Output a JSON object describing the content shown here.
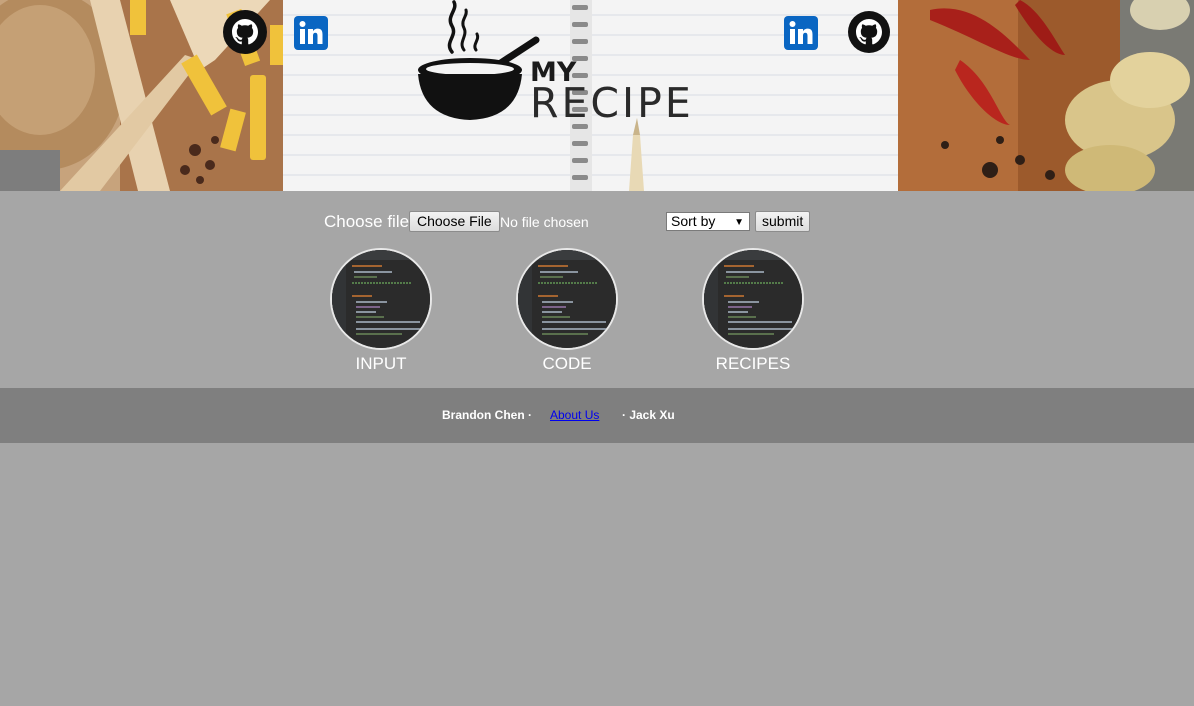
{
  "header": {
    "logo_my": "MY",
    "logo_recipe": "RECIPE",
    "social_links": [
      {
        "icon": "github-icon",
        "side": "left"
      },
      {
        "icon": "linkedin-icon",
        "side": "left"
      },
      {
        "icon": "linkedin-icon",
        "side": "right"
      },
      {
        "icon": "github-icon",
        "side": "right"
      }
    ]
  },
  "upload": {
    "label": "Choose file",
    "button_label": "Choose File",
    "status": "No file chosen"
  },
  "sort": {
    "selected": "Sort by",
    "submit_label": "submit"
  },
  "cards": [
    {
      "label": "INPUT"
    },
    {
      "label": "CODE"
    },
    {
      "label": "RECIPES"
    }
  ],
  "footer": {
    "left_name": "Brandon Chen ·",
    "link": "About Us",
    "right_name": "· Jack Xu"
  },
  "colors": {
    "page_bg": "#a6a6a6",
    "footer_bg": "#7f7f7f",
    "link": "#0000ee",
    "linkedin": "#0a66c2"
  }
}
